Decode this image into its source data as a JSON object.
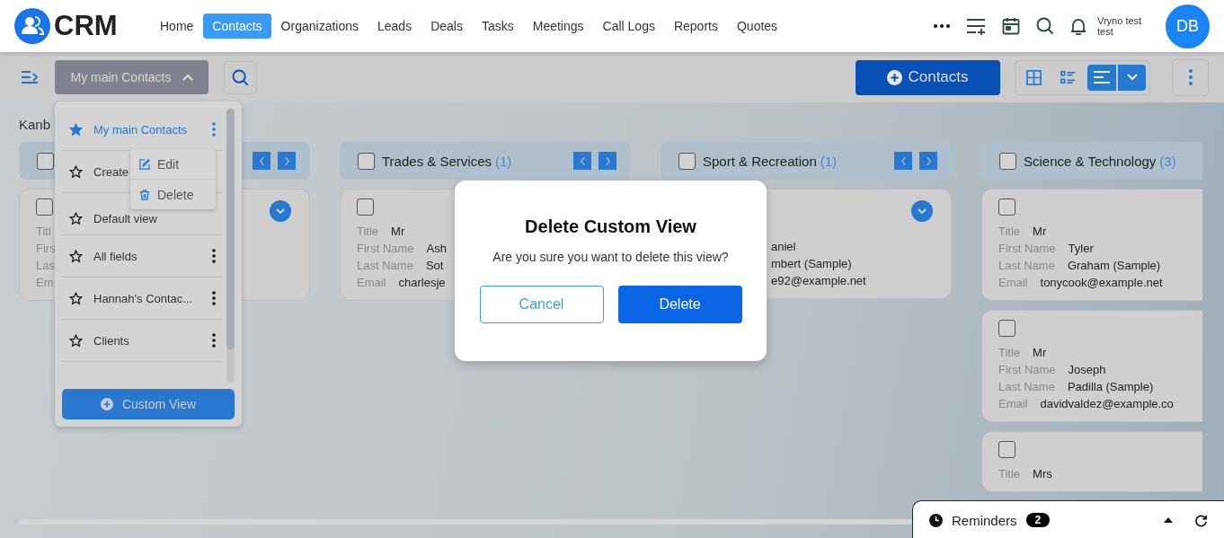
{
  "header": {
    "logo": "CRM",
    "nav": [
      {
        "label": "Home",
        "selected": false
      },
      {
        "label": "Contacts",
        "selected": true
      },
      {
        "label": "Organizations",
        "selected": false
      },
      {
        "label": "Leads",
        "selected": false
      },
      {
        "label": "Deals",
        "selected": false
      },
      {
        "label": "Tasks",
        "selected": false
      },
      {
        "label": "Meetings",
        "selected": false
      },
      {
        "label": "Call Logs",
        "selected": false
      },
      {
        "label": "Reports",
        "selected": false
      },
      {
        "label": "Quotes",
        "selected": false
      }
    ],
    "user": "Vryno test test",
    "avatar": "DB"
  },
  "toolbar": {
    "view_button": "My main Contacts",
    "add_button": "Contacts",
    "views": [
      {
        "kind": "grid",
        "selected": false
      },
      {
        "kind": "list",
        "selected": false
      },
      {
        "kind": "kanban",
        "selected": true
      }
    ]
  },
  "board": {
    "heading": "Kanb",
    "columns": [
      {
        "arrows": true,
        "checked": false,
        "cards": [
          {
            "checked": false,
            "expand": true,
            "fields": [
              {
                "label": "Titl"
              },
              {
                "label": "Firs"
              },
              {
                "label": "Las"
              },
              {
                "label": "Em"
              }
            ]
          }
        ]
      },
      {
        "title": "Trades & Services",
        "count": "(1)",
        "arrows": true,
        "checked": false,
        "cards": [
          {
            "checked": false,
            "expand": false,
            "fields": [
              {
                "label": "Title",
                "value": "Mr"
              },
              {
                "label": "First Name",
                "value": "Ash"
              },
              {
                "label": "Last Name",
                "value": "Sot"
              },
              {
                "label": "Email",
                "value": "charlesje"
              }
            ]
          }
        ]
      },
      {
        "title": "Sport & Recreation",
        "count": "(1)",
        "arrows": true,
        "checked": false,
        "cards": [
          {
            "expand": true,
            "fields": [
              {
                "value": "aniel"
              },
              {
                "value": "mbert (Sample)"
              },
              {
                "value": "e92@example.net"
              }
            ]
          }
        ]
      },
      {
        "title": "Science & Technology",
        "count": "(3)",
        "arrows": false,
        "checked": false,
        "cards": [
          {
            "checked": false,
            "expand": false,
            "fields": [
              {
                "label": "Title",
                "value": "Mr"
              },
              {
                "label": "First Name",
                "value": "Tyler"
              },
              {
                "label": "Last Name",
                "value": "Graham (Sample)"
              },
              {
                "label": "Email",
                "value": "tonycook@example.net"
              }
            ]
          },
          {
            "checked": false,
            "expand": false,
            "fields": [
              {
                "label": "Title",
                "value": "Mr"
              },
              {
                "label": "First Name",
                "value": "Joseph"
              },
              {
                "label": "Last Name",
                "value": "Padilla (Sample)"
              },
              {
                "label": "Email",
                "value": "davidvaldez@example.co"
              }
            ]
          },
          {
            "checked": false,
            "expand": false,
            "fields": [
              {
                "label": "Title",
                "value": "Mrs"
              }
            ]
          }
        ]
      }
    ]
  },
  "view_menu": {
    "items": [
      {
        "label": "My main Contacts",
        "selected": true,
        "dots": true
      },
      {
        "label": "Create",
        "selected": false,
        "dots": false
      },
      {
        "label": "Default view",
        "selected": false,
        "dots": false
      },
      {
        "label": "All fields",
        "selected": false,
        "dots": true
      },
      {
        "label": "Hannah's Contac...",
        "selected": false,
        "dots": true
      },
      {
        "label": "Clients",
        "selected": false,
        "dots": true
      }
    ],
    "button": "Custom View"
  },
  "item_menu": [
    {
      "kind": "edit",
      "label": "Edit"
    },
    {
      "kind": "delete",
      "label": "Delete"
    }
  ],
  "dialog": {
    "title": "Delete Custom View",
    "message": "Are you sure you want to delete this view?",
    "buttons": [
      {
        "kind": "secondary",
        "label": "Cancel"
      },
      {
        "kind": "primary",
        "label": "Delete"
      }
    ]
  },
  "reminders": {
    "label": "Reminders",
    "count": "2"
  }
}
